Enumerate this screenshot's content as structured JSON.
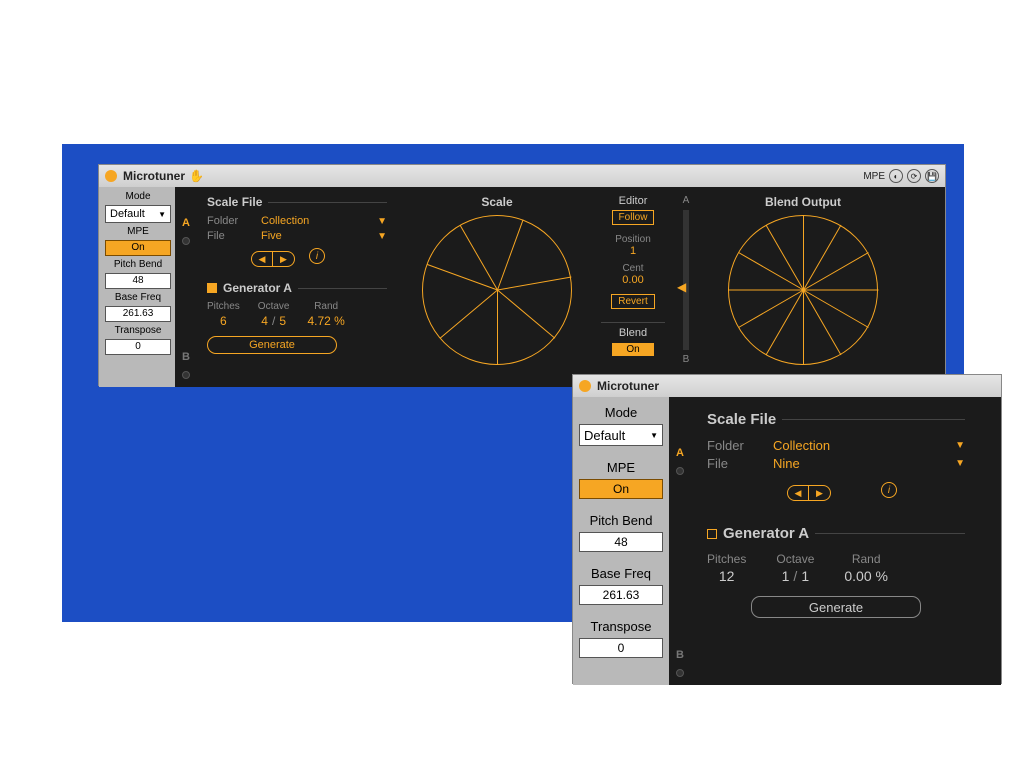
{
  "panel1": {
    "title": "Microtuner",
    "mpe_tag": "MPE",
    "left": {
      "mode_label": "Mode",
      "mode_value": "Default",
      "mpe_label": "MPE",
      "mpe_value": "On",
      "pitch_bend_label": "Pitch Bend",
      "pitch_bend_value": "48",
      "base_freq_label": "Base Freq",
      "base_freq_value": "261.63",
      "transpose_label": "Transpose",
      "transpose_value": "0"
    },
    "scale_file": {
      "heading": "Scale File",
      "folder_label": "Folder",
      "folder_value": "Collection",
      "file_label": "File",
      "file_value": "Five"
    },
    "generator": {
      "heading": "Generator A",
      "pitches_label": "Pitches",
      "pitches_value": "6",
      "octave_label": "Octave",
      "octave_value_a": "4",
      "octave_value_b": "5",
      "rand_label": "Rand",
      "rand_value": "4.72 %",
      "button": "Generate"
    },
    "scale_heading": "Scale",
    "scale_angles": [
      0,
      50,
      110,
      150,
      200,
      260,
      310
    ],
    "editor": {
      "heading": "Editor",
      "follow": "Follow",
      "position_label": "Position",
      "position_value": "1",
      "cent_label": "Cent",
      "cent_value": "0.00",
      "revert": "Revert",
      "blend_label": "Blend",
      "blend_value": "On"
    },
    "slider": {
      "a": "A",
      "b": "B"
    },
    "blend_output": {
      "heading": "Blend Output",
      "angles": [
        0,
        30,
        60,
        90,
        120,
        150,
        180,
        210,
        240,
        270,
        300,
        330
      ]
    }
  },
  "panel2": {
    "title": "Microtuner",
    "left": {
      "mode_label": "Mode",
      "mode_value": "Default",
      "mpe_label": "MPE",
      "mpe_value": "On",
      "pitch_bend_label": "Pitch Bend",
      "pitch_bend_value": "48",
      "base_freq_label": "Base Freq",
      "base_freq_value": "261.63",
      "transpose_label": "Transpose",
      "transpose_value": "0"
    },
    "scale_file": {
      "heading": "Scale File",
      "folder_label": "Folder",
      "folder_value": "Collection",
      "file_label": "File",
      "file_value": "Nine"
    },
    "generator": {
      "heading": "Generator A",
      "pitches_label": "Pitches",
      "pitches_value": "12",
      "octave_label": "Octave",
      "octave_value_a": "1",
      "octave_value_b": "1",
      "rand_label": "Rand",
      "rand_value": "0.00 %",
      "button": "Generate"
    }
  }
}
